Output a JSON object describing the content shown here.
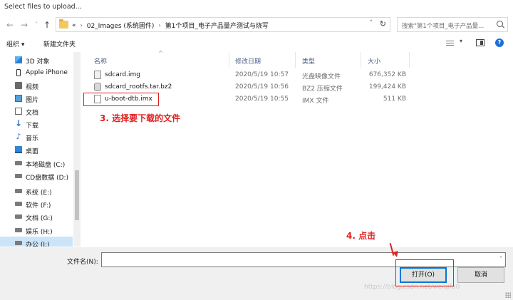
{
  "window": {
    "title": "Select files to upload..."
  },
  "address_bar": {
    "overflow": "«",
    "crumbs": [
      "02_Images (系统固件)",
      "第1个项目_电子产品量产测试与烧写"
    ],
    "search_placeholder": "搜索\"第1个项目_电子产品量..."
  },
  "toolbar": {
    "organize": "组织 ▾",
    "new_folder": "新建文件夹"
  },
  "sidebar": {
    "items": [
      {
        "label": "3D 对象",
        "icon": "3d-objects-icon"
      },
      {
        "label": "Apple iPhone",
        "icon": "phone-icon"
      },
      {
        "label": "视频",
        "icon": "video-icon"
      },
      {
        "label": "图片",
        "icon": "pictures-icon"
      },
      {
        "label": "文档",
        "icon": "documents-icon"
      },
      {
        "label": "下载",
        "icon": "download-icon"
      },
      {
        "label": "音乐",
        "icon": "music-icon"
      },
      {
        "label": "桌面",
        "icon": "desktop-icon"
      },
      {
        "label": "本地磁盘 (C:)",
        "icon": "drive-icon"
      },
      {
        "label": "CD盘数据 (D:)",
        "icon": "drive-icon"
      },
      {
        "label": "系统 (E:)",
        "icon": "drive-icon"
      },
      {
        "label": "软件 (F:)",
        "icon": "drive-icon"
      },
      {
        "label": "文档 (G:)",
        "icon": "drive-icon"
      },
      {
        "label": "娱乐 (H:)",
        "icon": "drive-icon"
      },
      {
        "label": "办公 (I:)",
        "icon": "drive-icon"
      }
    ]
  },
  "file_list": {
    "columns": {
      "name": "名称",
      "date": "修改日期",
      "type": "类型",
      "size": "大小"
    },
    "files": [
      {
        "name": "sdcard.img",
        "date": "2020/5/19 10:57",
        "type": "光盘映像文件",
        "size": "676,352 KB"
      },
      {
        "name": "sdcard_rootfs.tar.bz2",
        "date": "2020/5/19 10:56",
        "type": "BZ2 压缩文件",
        "size": "199,424 KB"
      },
      {
        "name": "u-boot-dtb.imx",
        "date": "2020/5/19 10:55",
        "type": "IMX 文件",
        "size": "511 KB"
      }
    ]
  },
  "annotations": {
    "step3": "3. 选择要下载的文件",
    "step4": "4. 点击"
  },
  "bottom": {
    "filename_label": "文件名(N):",
    "filename_value": "",
    "open_button": "打开(O)",
    "cancel_button": "取消",
    "watermark": "https://blog.csdn.net/weiqifa0"
  },
  "colors": {
    "annotation": "#e02020",
    "selection": "#cce4f7",
    "accent": "#0078d7"
  }
}
